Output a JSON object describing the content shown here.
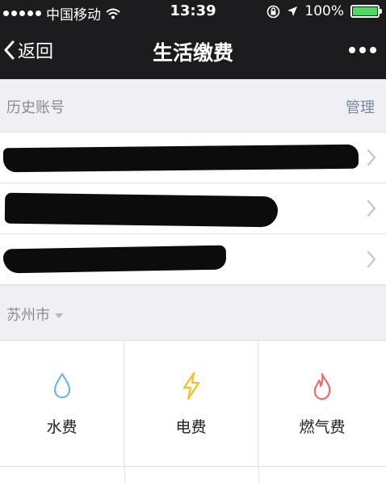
{
  "status_bar": {
    "carrier": "中国移动",
    "time": "13:39",
    "battery": "100%",
    "signal_icon": "signal-dots-icon",
    "wifi_icon": "wifi-icon",
    "lock_icon": "rotation-lock-icon",
    "location_icon": "location-arrow-icon",
    "battery_icon": "battery-icon",
    "battery_color": "#4cd964"
  },
  "nav": {
    "back_label": "返回",
    "title": "生活缴费",
    "more_icon": "more-dots-icon"
  },
  "history": {
    "header_label": "历史账号",
    "manage_label": "管理",
    "accounts": [
      "",
      "",
      ""
    ]
  },
  "city": {
    "name": "苏州市"
  },
  "services": [
    {
      "label": "水费",
      "icon": "water-drop-icon",
      "color": "#6fb6e6"
    },
    {
      "label": "电费",
      "icon": "lightning-icon",
      "color": "#f4c11c"
    },
    {
      "label": "燃气费",
      "icon": "flame-icon",
      "color": "#f06a6a"
    }
  ]
}
